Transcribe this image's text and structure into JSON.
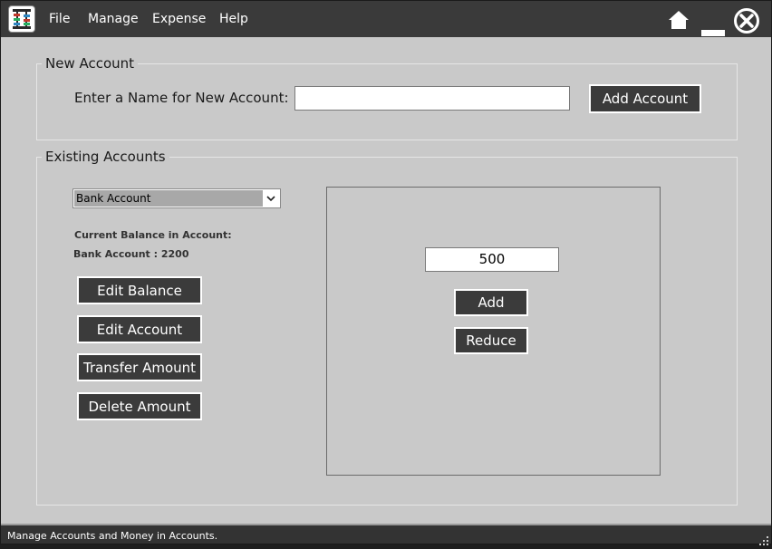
{
  "menu": {
    "file": "File",
    "manage": "Manage",
    "expense": "Expense",
    "help": "Help"
  },
  "titlebar_icons": [
    "home-icon",
    "minimize-icon",
    "close-icon"
  ],
  "new_account": {
    "group_title": "New Account",
    "name_label": "Enter a Name for New Account:",
    "name_value": "",
    "add_button": "Add Account"
  },
  "existing_accounts": {
    "group_title": "Existing Accounts",
    "selected_account": "Bank Account",
    "balance_label": "Current Balance in Account:",
    "balance_value": "Bank Account : 2200",
    "buttons": {
      "edit_balance": "Edit Balance",
      "edit_account": "Edit Account",
      "transfer_amount": "Transfer Amount",
      "delete_amount": "Delete Amount"
    },
    "amount_value": "500",
    "add_button": "Add",
    "reduce_button": "Reduce"
  },
  "status": {
    "text": "Manage Accounts and Money in Accounts."
  },
  "colors": {
    "background": "#c9c9c9",
    "titlebar": "#3a3a3a",
    "button": "#3b3b3b",
    "statusbar": "#333333"
  }
}
